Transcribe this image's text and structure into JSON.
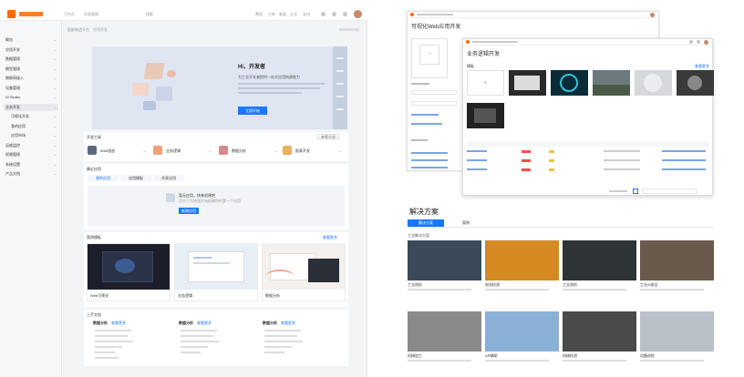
{
  "console": {
    "top_menu": [
      "工作台",
      "资源管理",
      "搜索",
      "费用",
      "工单",
      "备案",
      "企业",
      "支持"
    ],
    "breadcrumb": [
      "智能制造平台",
      "应用开发"
    ],
    "sidebar_items": [
      "概览",
      "应用开发",
      "数据管理",
      "模型管理",
      "物联网接入",
      "设备管理",
      "AI Studio",
      "业务开发",
      "可视化开发",
      "我的应用",
      "应用市场",
      "运维监控",
      "权限管理",
      "系统设置",
      "产品文档"
    ],
    "sidebar_active": 7,
    "hero": {
      "title": "Hi，开发者",
      "subtitle": "为工业开发者提供一站式应用构建能力",
      "button": "立即开始"
    },
    "dev_tools": {
      "title": "开发工具",
      "more": "查看全部",
      "items": [
        "Web组态",
        "业务逻辑",
        "数据分析",
        "报表开发"
      ]
    },
    "recent": {
      "title": "最近应用",
      "tabs": [
        "我的应用",
        "应用模板",
        "共享应用"
      ],
      "empty_title": "暂无应用，快来创建吧",
      "empty_desc": "点击下方按钮开始创建你的第一个应用",
      "create_button": "新建应用"
    },
    "examples": {
      "title": "案例模板",
      "more": "查看更多",
      "items": [
        "Web可视化",
        "业务逻辑",
        "数据分析"
      ]
    },
    "learn": {
      "title": "上手文档",
      "columns": [
        {
          "title": "数据分析",
          "link": "查看更多"
        },
        {
          "title": "数据分析",
          "link": "查看更多"
        },
        {
          "title": "数据分析",
          "link": "查看更多"
        }
      ]
    }
  },
  "right": {
    "back_window": {
      "title": "可视化Web应用开发"
    },
    "front_window": {
      "title": "业务逻辑开发",
      "section": "模板",
      "more": "查看更多"
    },
    "solutions": {
      "title": "解决方案",
      "tabs": [
        "解决方案",
        "案例"
      ],
      "subtitle": "工业解决方案",
      "cards": [
        "工业质检",
        "电池检测",
        "工业质检",
        "工业AI安全",
        "机械加工",
        "AR辅助",
        "机械检测",
        "设备巡检"
      ]
    }
  }
}
